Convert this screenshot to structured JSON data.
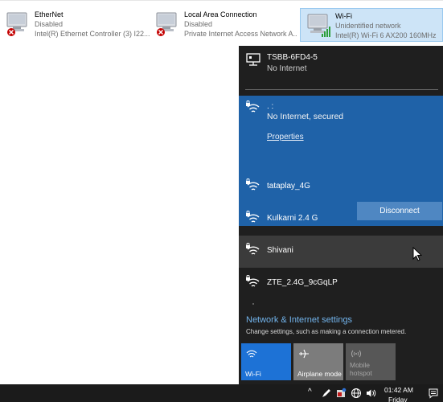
{
  "adapters": [
    {
      "name": "EtherNet",
      "status": "Disabled",
      "device": "Intel(R) Ethernet Controller (3) I22..."
    },
    {
      "name": "Local Area Connection",
      "status": "Disabled",
      "device": "Private Internet Access Network A..."
    },
    {
      "name": "Wi-Fi",
      "status": "Unidentified network",
      "device": "Intel(R) Wi-Fi 6 AX200 160MHz"
    }
  ],
  "flyout": {
    "wired": {
      "name": "TSBB-6FD4-5",
      "status": "No Internet"
    },
    "active": {
      "name": ". :",
      "status": "No Internet, secured",
      "properties_label": "Properties",
      "disconnect_label": "Disconnect"
    },
    "networks": [
      {
        "name": "tataplay_4G"
      },
      {
        "name": "Kulkarni 2.4 G"
      },
      {
        "name": "Shivani"
      },
      {
        "name": "ZTE_2.4G_9cGqLP"
      }
    ],
    "settings": {
      "title": "Network & Internet settings",
      "subtitle": "Change settings, such as making a connection metered."
    },
    "quick_actions": [
      {
        "label": "Wi-Fi",
        "icon": "wifi-icon",
        "state": "on"
      },
      {
        "label": "Airplane mode",
        "icon": "airplane-icon",
        "state": "off"
      },
      {
        "label": "Mobile hotspot",
        "icon": "hotspot-icon",
        "state": "disabled"
      }
    ]
  },
  "taskbar": {
    "time": "01:42 AM",
    "day": "Friday"
  },
  "colors": {
    "flyout_bg": "#1f1f1f",
    "accent": "#1f62a8",
    "quick_wifi": "#1d72d6",
    "link": "#72b4ec"
  }
}
